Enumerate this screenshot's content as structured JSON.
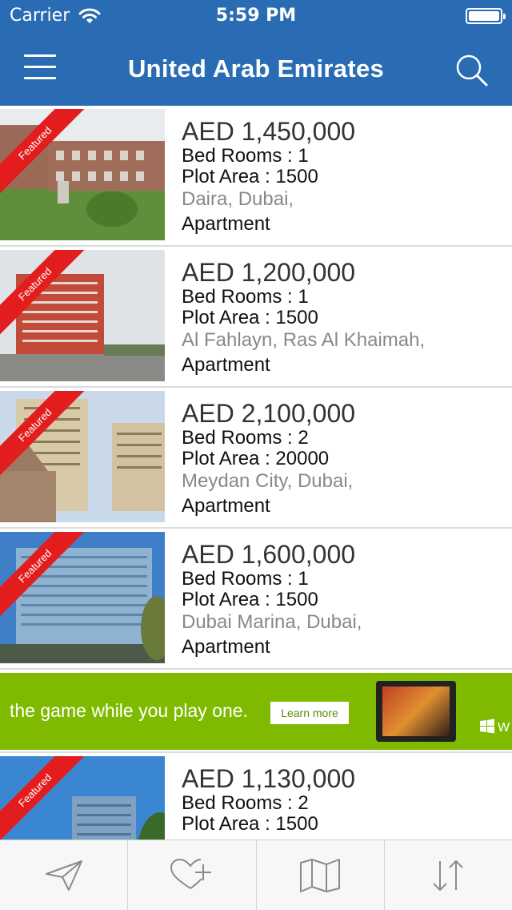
{
  "status_bar": {
    "carrier": "Carrier",
    "time": "5:59 PM"
  },
  "nav": {
    "title": "United Arab Emirates",
    "menu_icon": "hamburger-icon",
    "search_icon": "search-icon"
  },
  "listings": [
    {
      "ribbon": "Featured",
      "price": "AED 1,450,000",
      "bedrooms": "Bed Rooms : 1",
      "plot_area": "Plot Area : 1500",
      "location": "Daira, Dubai,",
      "type": "Apartment"
    },
    {
      "ribbon": "Featured",
      "price": "AED 1,200,000",
      "bedrooms": "Bed Rooms : 1",
      "plot_area": "Plot Area : 1500",
      "location": "Al Fahlayn, Ras Al Khaimah,",
      "type": "Apartment"
    },
    {
      "ribbon": "Featured",
      "price": "AED 2,100,000",
      "bedrooms": "Bed Rooms : 2",
      "plot_area": "Plot Area : 20000",
      "location": "Meydan City, Dubai,",
      "type": "Apartment"
    },
    {
      "ribbon": "Featured",
      "price": "AED 1,600,000",
      "bedrooms": "Bed Rooms : 1",
      "plot_area": "Plot Area : 1500",
      "location": "Dubai Marina, Dubai,",
      "type": "Apartment"
    },
    {
      "ribbon": "Featured",
      "price": "AED 1,130,000",
      "bedrooms": "Bed Rooms : 2",
      "plot_area": "Plot Area : 1500",
      "location": "",
      "type": ""
    }
  ],
  "ad": {
    "text": "the game while you play one.",
    "button": "Learn more"
  },
  "tab_bar": {
    "icons": [
      "send-icon",
      "add-favorite-icon",
      "map-icon",
      "sort-icon"
    ]
  },
  "colors": {
    "primary": "#2a6cb4",
    "ribbon": "#e31d1d",
    "ad_green": "#7fba00"
  }
}
